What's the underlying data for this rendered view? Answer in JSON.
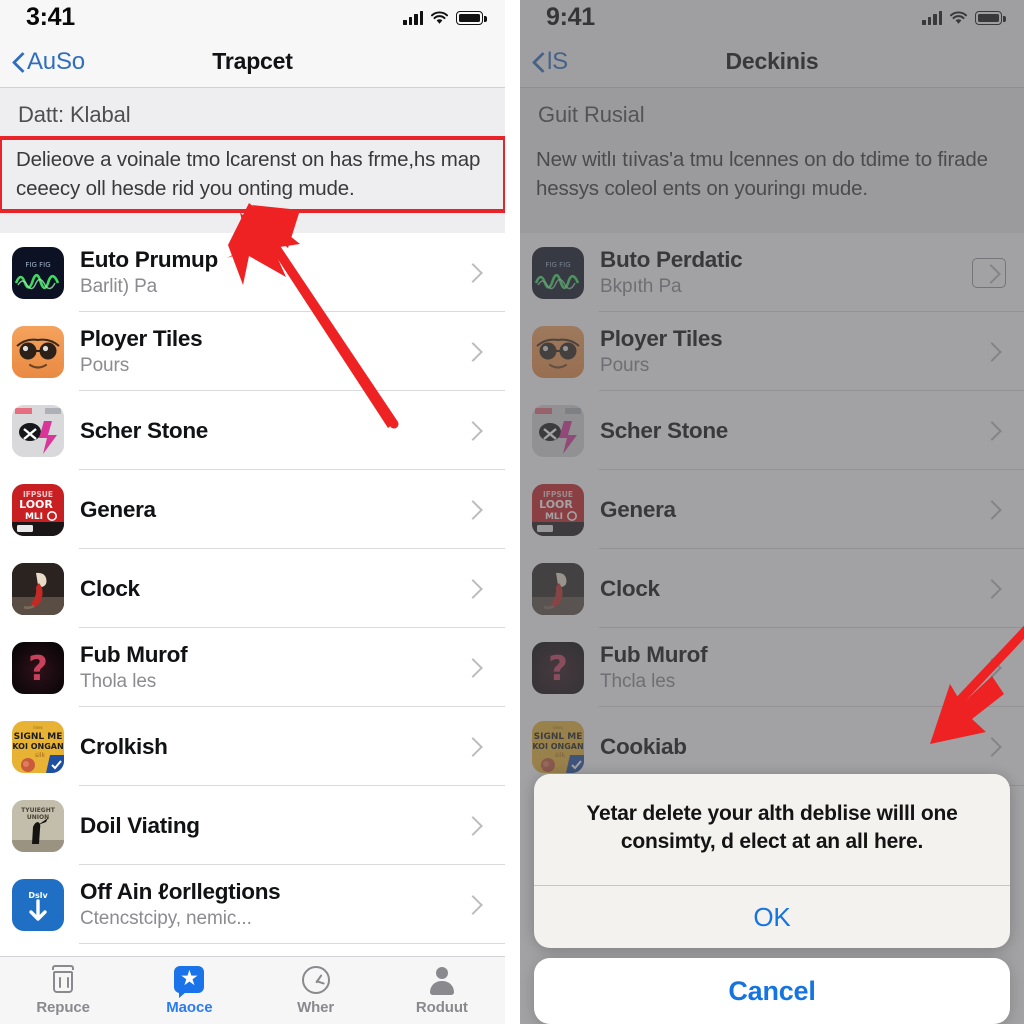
{
  "left_phone": {
    "status": {
      "time": "3:41",
      "signal_icon": "cellular-bars-icon",
      "wifi_icon": "wifi-icon",
      "battery_icon": "battery-full-icon"
    },
    "nav": {
      "back_label": "AuSo",
      "title": "Trapcet",
      "back_icon": "chevron-left-icon"
    },
    "banner": {
      "label": "Datt: Klabal",
      "body": "Delieove a voinale tmo lcarenst on has frme,hs map ceeecy oll hesde rid you onting mude.",
      "highlight_color": "#e8232a"
    },
    "rows": [
      {
        "title": "Euto Prumup",
        "subtitle": "Barlit) Pa",
        "icon": "app-icon-euto-prumup",
        "chevron": "chevron-right-icon",
        "boxed_chevron": false
      },
      {
        "title": "Ployer Tiles",
        "subtitle": "Pours",
        "icon": "app-icon-ployer-tiles",
        "chevron": "chevron-right-icon",
        "boxed_chevron": false
      },
      {
        "title": "Scher Stone",
        "subtitle": "",
        "icon": "app-icon-scher-stone",
        "chevron": "chevron-right-icon",
        "boxed_chevron": false
      },
      {
        "title": "Genera",
        "subtitle": "",
        "icon": "app-icon-genera",
        "chevron": "chevron-right-icon",
        "boxed_chevron": false
      },
      {
        "title": "Clock",
        "subtitle": "",
        "icon": "app-icon-clock",
        "chevron": "chevron-right-icon",
        "boxed_chevron": false
      },
      {
        "title": "Fub Murof",
        "subtitle": "Thola les",
        "icon": "app-icon-fub-murof",
        "chevron": "chevron-right-icon",
        "boxed_chevron": false
      },
      {
        "title": "Crolkish",
        "subtitle": "",
        "icon": "app-icon-crolkish",
        "chevron": "chevron-right-icon",
        "boxed_chevron": false
      },
      {
        "title": "Doil Viating",
        "subtitle": "",
        "icon": "app-icon-doil-viating",
        "chevron": "chevron-right-icon",
        "boxed_chevron": false
      },
      {
        "title": "Off Ain ℓorllegtions",
        "subtitle": "Ctencstcipy, nemic...",
        "icon": "app-icon-off-ain",
        "chevron": "chevron-right-icon",
        "boxed_chevron": false
      }
    ],
    "tabs": [
      {
        "label": "Repuce",
        "icon": "trash-icon",
        "active": false
      },
      {
        "label": "Maoce",
        "icon": "message-star-icon",
        "active": true
      },
      {
        "label": "Wher",
        "icon": "speedometer-icon",
        "active": false
      },
      {
        "label": "Roduut",
        "icon": "person-icon",
        "active": false
      }
    ]
  },
  "right_phone": {
    "status": {
      "time": "9:41",
      "signal_icon": "cellular-bars-icon",
      "wifi_icon": "wifi-icon",
      "battery_icon": "battery-full-icon"
    },
    "nav": {
      "back_label": "lS",
      "title": "Deckinis",
      "back_icon": "chevron-left-icon"
    },
    "banner": {
      "label": "Guit Rusial",
      "body": "New witlı tıivas'a tmu lcennes on do tdime to firade hessys coleol ents on youringı mude."
    },
    "rows": [
      {
        "title": "Buto Perdatic",
        "subtitle": "Bkpıth Pa",
        "icon": "app-icon-euto-prumup",
        "chevron": "chevron-right-icon",
        "boxed_chevron": true
      },
      {
        "title": "Ployer Tiles",
        "subtitle": "Pours",
        "icon": "app-icon-ployer-tiles",
        "chevron": "chevron-right-icon",
        "boxed_chevron": false
      },
      {
        "title": "Scher Stone",
        "subtitle": "",
        "icon": "app-icon-scher-stone",
        "chevron": "chevron-right-icon",
        "boxed_chevron": false
      },
      {
        "title": "Genera",
        "subtitle": "",
        "icon": "app-icon-genera",
        "chevron": "chevron-right-icon",
        "boxed_chevron": false
      },
      {
        "title": "Clock",
        "subtitle": "",
        "icon": "app-icon-clock",
        "chevron": "chevron-right-icon",
        "boxed_chevron": false
      },
      {
        "title": "Fub Murof",
        "subtitle": "Thcla les",
        "icon": "app-icon-fub-murof",
        "chevron": "chevron-right-icon",
        "boxed_chevron": false
      },
      {
        "title": "Cookiab",
        "subtitle": "",
        "icon": "app-icon-crolkish",
        "chevron": "chevron-right-icon",
        "boxed_chevron": false
      }
    ],
    "alert": {
      "message": "Yetar delete your alth deblise willl one consimty, d elect at an all here.",
      "ok_label": "OK",
      "cancel_label": "Cancel",
      "accent_color": "#1575e0"
    }
  },
  "annotations": {
    "arrow_color": "#ee2222",
    "left_arrow": "points-up-left-to-highlighted-banner",
    "right_arrow": "points-down-left-to-list-row"
  }
}
